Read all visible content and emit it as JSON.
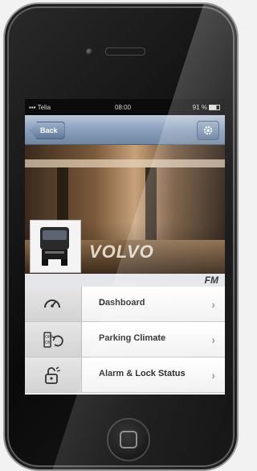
{
  "status_bar": {
    "carrier": "Telia",
    "time": "08:00",
    "battery": "91 %"
  },
  "nav": {
    "back_label": "Back"
  },
  "hero": {
    "brand_text": "VOLVO"
  },
  "model": {
    "label": "FM"
  },
  "menu": {
    "items": [
      {
        "label": "Dashboard",
        "icon": "speedometer-icon"
      },
      {
        "label": "Parking Climate",
        "icon": "parking-climate-icon"
      },
      {
        "label": "Alarm & Lock Status",
        "icon": "lock-icon"
      }
    ]
  }
}
